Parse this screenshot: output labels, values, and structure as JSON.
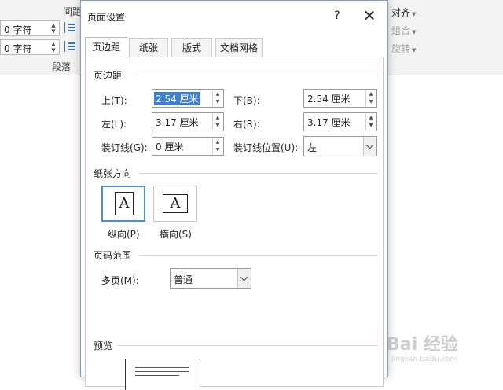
{
  "ribbon": {
    "spacing_label": "间距",
    "indent_before": "0 字符",
    "indent_after": "0 字符",
    "group_label": "段落",
    "align_label": "对齐",
    "group_cmd_label": "组合",
    "rotate_label": "旋转"
  },
  "dialog": {
    "title": "页面设置",
    "help": "?",
    "tabs": [
      {
        "label": "页边距",
        "active": true
      },
      {
        "label": "纸张",
        "active": false
      },
      {
        "label": "版式",
        "active": false
      },
      {
        "label": "文档网格",
        "active": false
      }
    ],
    "margins": {
      "section_title": "页边距",
      "top_label": "上(T):",
      "top_value": "2.54 厘米",
      "bottom_label": "下(B):",
      "bottom_value": "2.54 厘米",
      "left_label": "左(L):",
      "left_value": "3.17 厘米",
      "right_label": "右(R):",
      "right_value": "3.17 厘米",
      "gutter_label": "装订线(G):",
      "gutter_value": "0 厘米",
      "gutter_pos_label": "装订线位置(U):",
      "gutter_pos_value": "左"
    },
    "orientation": {
      "section_title": "纸张方向",
      "portrait_label": "纵向(P)",
      "landscape_label": "横向(S)",
      "icon_letter": "A",
      "selected": "portrait"
    },
    "pages": {
      "section_title": "页码范围",
      "multiple_label": "多页(M):",
      "multiple_value": "普通"
    },
    "preview": {
      "section_title": "预览"
    }
  },
  "watermark": {
    "main": "Bai 经验",
    "sub": "jingyan.baidu.com"
  },
  "colors": {
    "accent": "#3f7fd1",
    "dialog_border": "#7a9cc6",
    "ribbon_bg": "#f3f3f3"
  }
}
